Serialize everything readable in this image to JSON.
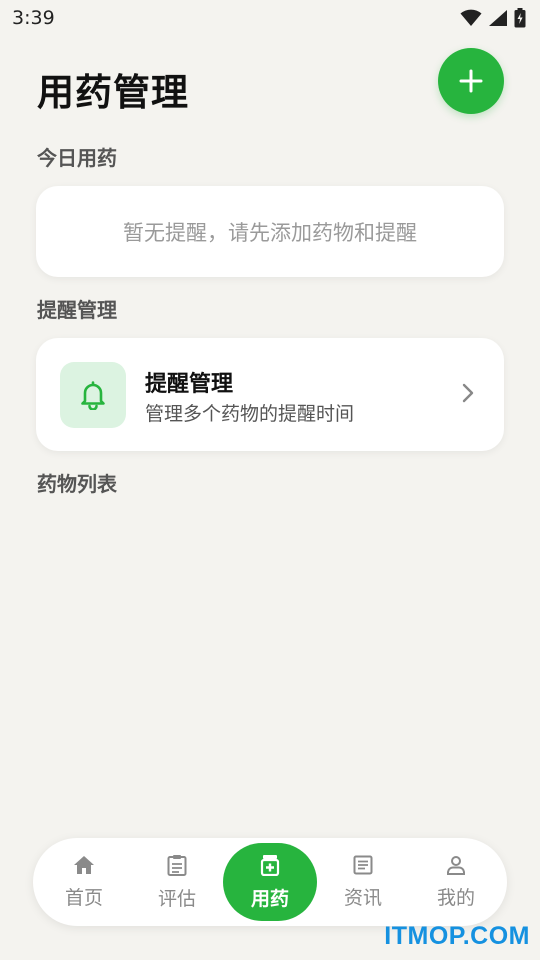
{
  "status_bar": {
    "time": "3:39"
  },
  "header": {
    "title": "用药管理",
    "add_icon": "plus-icon"
  },
  "colors": {
    "accent": "#27b43e",
    "accent_light": "#dcf3e1",
    "background": "#f4f3ef",
    "watermark": "#1591e0"
  },
  "sections": {
    "today": {
      "label": "今日用药",
      "empty_text": "暂无提醒，请先添加药物和提醒"
    },
    "reminders": {
      "label": "提醒管理",
      "card": {
        "icon": "bell-icon",
        "title": "提醒管理",
        "subtitle": "管理多个药物的提醒时间"
      }
    },
    "medicines": {
      "label": "药物列表"
    }
  },
  "bottom_nav": {
    "items": [
      {
        "label": "首页",
        "icon": "home-icon",
        "active": false
      },
      {
        "label": "评估",
        "icon": "clipboard-icon",
        "active": false
      },
      {
        "label": "用药",
        "icon": "medicine-icon",
        "active": true
      },
      {
        "label": "资讯",
        "icon": "article-icon",
        "active": false
      },
      {
        "label": "我的",
        "icon": "person-icon",
        "active": false
      }
    ]
  },
  "watermark": "ITMOP.COM"
}
